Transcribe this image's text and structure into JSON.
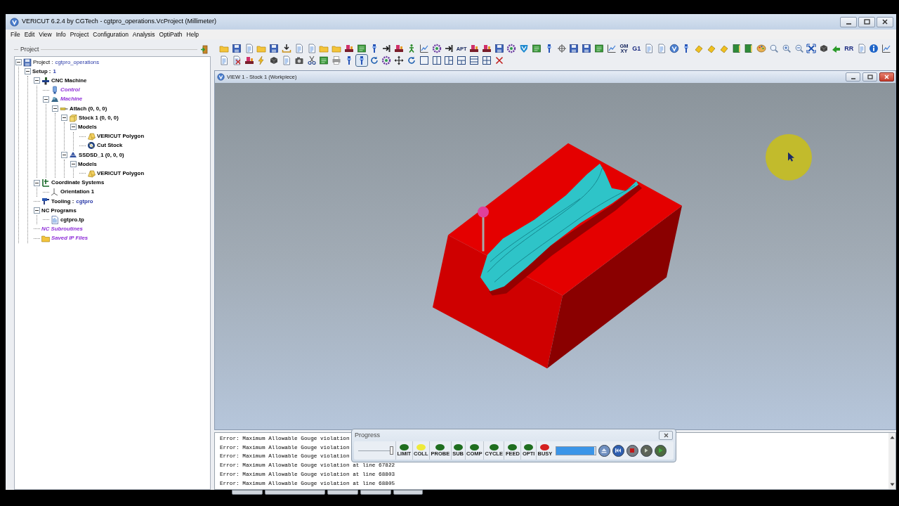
{
  "window": {
    "title": "VERICUT 6.2.4 by CGTech - cgtpro_operations.VcProject (Millimeter)"
  },
  "menu": [
    "File",
    "Edit",
    "View",
    "Info",
    "Project",
    "Configuration",
    "Analysis",
    "OptiPath",
    "Help"
  ],
  "project_panel": {
    "title": "Project",
    "tree": [
      {
        "kind": "project",
        "label": "Project :",
        "value": "cgtpro_operations",
        "empty": false,
        "expanded": true,
        "children": [
          {
            "kind": "setup",
            "label": "Setup :",
            "value": "1",
            "empty": false,
            "expanded": true,
            "children": [
              {
                "kind": "machine",
                "label": "CNC Machine",
                "empty": false,
                "expanded": true,
                "children": [
                  {
                    "kind": "control",
                    "label": "Control",
                    "empty": true
                  },
                  {
                    "kind": "component",
                    "label": "Machine",
                    "empty": true,
                    "expanded": true,
                    "children": [
                      {
                        "kind": "attach",
                        "label": "Attach (0, 0, 0)",
                        "empty": false,
                        "expanded": true,
                        "children": [
                          {
                            "kind": "stock",
                            "label": "Stock 1 (0, 0, 0)",
                            "empty": false,
                            "expanded": true,
                            "children": [
                              {
                                "kind": "models",
                                "label": "Models",
                                "empty": false,
                                "expanded": true,
                                "children": [
                                  {
                                    "kind": "polygon",
                                    "label": "VERICUT Polygon",
                                    "empty": false
                                  },
                                  {
                                    "kind": "cut-stock",
                                    "label": "Cut Stock",
                                    "empty": false
                                  }
                                ]
                              }
                            ]
                          },
                          {
                            "kind": "fixture",
                            "label": "SSDSD_1 (0, 0, 0)",
                            "empty": false,
                            "expanded": true,
                            "children": [
                              {
                                "kind": "models",
                                "label": "Models",
                                "empty": false,
                                "expanded": true,
                                "children": [
                                  {
                                    "kind": "polygon",
                                    "label": "VERICUT Polygon",
                                    "empty": false
                                  }
                                ]
                              }
                            ]
                          }
                        ]
                      }
                    ]
                  }
                ]
              },
              {
                "kind": "coords",
                "label": "Coordinate Systems",
                "empty": false,
                "expanded": true,
                "children": [
                  {
                    "kind": "orientation",
                    "label": "Orientation 1",
                    "empty": false
                  }
                ]
              },
              {
                "kind": "tooling",
                "label": "Tooling :",
                "value": "cgtpro",
                "empty": false
              },
              {
                "kind": "programs",
                "label": "NC Programs",
                "empty": false,
                "expanded": true,
                "children": [
                  {
                    "kind": "nc-file",
                    "label": "cgtpro.tp",
                    "empty": false
                  }
                ]
              },
              {
                "kind": "subroutines",
                "label": "NC Subroutines",
                "empty": true
              },
              {
                "kind": "saved-files",
                "label": "Saved IP Files",
                "empty": true
              }
            ]
          }
        ]
      }
    ]
  },
  "toolbar": {
    "rows": [
      [
        {
          "kind": "folder",
          "selected": false
        },
        {
          "kind": "disk",
          "selected": false
        },
        {
          "kind": "page",
          "selected": false
        },
        {
          "kind": "folder",
          "selected": false
        },
        {
          "kind": "disk",
          "selected": false
        },
        {
          "kind": "download",
          "selected": false
        },
        {
          "kind": "page",
          "selected": false
        },
        {
          "kind": "page",
          "selected": false
        },
        {
          "kind": "folder",
          "selected": false
        },
        {
          "kind": "folder",
          "selected": false
        },
        {
          "kind": "machine",
          "selected": false
        },
        {
          "kind": "board",
          "selected": false
        },
        {
          "kind": "tool",
          "selected": false
        },
        {
          "kind": "arrow",
          "selected": false
        },
        {
          "kind": "machine",
          "selected": false
        },
        {
          "kind": "figure",
          "selected": false
        },
        {
          "kind": "chart",
          "selected": false
        },
        {
          "kind": "gear",
          "selected": false
        },
        {
          "kind": "arrow",
          "selected": false
        },
        {
          "kind": "label-small",
          "text": "APT",
          "selected": false
        },
        {
          "kind": "machine",
          "selected": false
        },
        {
          "kind": "machine",
          "selected": false
        },
        {
          "kind": "disk",
          "selected": false
        },
        {
          "kind": "gear",
          "selected": false
        },
        {
          "kind": "shield",
          "selected": false
        },
        {
          "kind": "board",
          "selected": false
        },
        {
          "kind": "tool",
          "selected": false
        },
        {
          "kind": "crosshair",
          "selected": false
        },
        {
          "kind": "disk",
          "selected": false
        },
        {
          "kind": "disk",
          "selected": false
        },
        {
          "kind": "board",
          "selected": false
        },
        {
          "kind": "chart",
          "selected": false
        },
        {
          "kind": "label-small",
          "text": "GM XY",
          "selected": false
        },
        {
          "kind": "label",
          "text": "G1",
          "selected": false
        },
        {
          "kind": "page",
          "selected": false
        },
        {
          "kind": "page",
          "selected": false
        },
        {
          "kind": "vlogo",
          "selected": false
        },
        {
          "kind": "tool",
          "selected": false
        },
        {
          "kind": "eraser",
          "selected": false
        },
        {
          "kind": "eraser",
          "selected": false
        },
        {
          "kind": "eraser",
          "selected": false
        },
        {
          "kind": "book",
          "selected": false
        },
        {
          "kind": "book",
          "selected": false
        },
        {
          "kind": "palette",
          "selected": false
        },
        {
          "kind": "zoom",
          "selected": false
        },
        {
          "kind": "zoom-in",
          "selected": false
        },
        {
          "kind": "zoom-out",
          "selected": false
        },
        {
          "kind": "fit",
          "selected": false
        },
        {
          "kind": "cube",
          "selected": false
        },
        {
          "kind": "arrow-green",
          "selected": false
        },
        {
          "kind": "label",
          "text": "RR",
          "selected": false
        },
        {
          "kind": "page",
          "selected": false
        },
        {
          "kind": "info",
          "selected": false
        },
        {
          "kind": "chart",
          "selected": false
        }
      ],
      [
        {
          "kind": "page",
          "selected": false
        },
        {
          "kind": "page-x",
          "selected": false
        },
        {
          "kind": "machine",
          "selected": false
        },
        {
          "kind": "lightning",
          "selected": false
        },
        {
          "kind": "cube",
          "selected": false
        },
        {
          "kind": "page",
          "selected": false
        },
        {
          "kind": "camera",
          "selected": false
        },
        {
          "kind": "scissors",
          "selected": false
        },
        {
          "kind": "board",
          "selected": false
        },
        {
          "kind": "printer",
          "selected": false
        },
        {
          "kind": "tool",
          "selected": false
        },
        {
          "kind": "tool",
          "selected": true
        },
        {
          "kind": "rotate",
          "selected": false
        },
        {
          "kind": "gear",
          "selected": false
        },
        {
          "kind": "move",
          "selected": false
        },
        {
          "kind": "rotate",
          "selected": false
        },
        {
          "kind": "layout1",
          "selected": false
        },
        {
          "kind": "layout2",
          "selected": false
        },
        {
          "kind": "layout3",
          "selected": false
        },
        {
          "kind": "layout4",
          "selected": false
        },
        {
          "kind": "layout5",
          "selected": false
        },
        {
          "kind": "grid",
          "selected": false
        },
        {
          "kind": "close",
          "selected": false
        }
      ]
    ]
  },
  "view": {
    "title": "VIEW 1 - Stock 1 (Workpiece)"
  },
  "console": {
    "lines": [
      "Error: Maximum Allowable Gouge violation",
      "Error: Maximum Allowable Gouge violation",
      "Error: Maximum Allowable Gouge violation",
      "Error: Maximum Allowable Gouge violation at line 67822",
      "Error: Maximum Allowable Gouge violation at line 68803",
      "Error: Maximum Allowable Gouge violation at line 68805"
    ]
  },
  "progress_dialog": {
    "title": "Progress",
    "slider": {
      "level": 1
    },
    "lights": [
      {
        "label": "LIMIT",
        "color": "#1f6e1f"
      },
      {
        "label": "COLL",
        "color": "#eeea3a"
      },
      {
        "label": "PROBE",
        "color": "#1f6e1f"
      },
      {
        "label": "SUB",
        "color": "#1f6e1f"
      },
      {
        "label": "COMP",
        "color": "#1f6e1f"
      },
      {
        "label": "CYCLE",
        "color": "#1f6e1f"
      },
      {
        "label": "FEED",
        "color": "#1f6e1f"
      },
      {
        "label": "OPTI",
        "color": "#1f6e1f"
      },
      {
        "label": "BUSY",
        "color": "#d42020"
      }
    ],
    "progress": {
      "level": 0.96
    },
    "buttons": [
      {
        "kind": "reset"
      },
      {
        "kind": "rewind"
      },
      {
        "kind": "stop"
      },
      {
        "kind": "step"
      },
      {
        "kind": "play"
      }
    ]
  }
}
